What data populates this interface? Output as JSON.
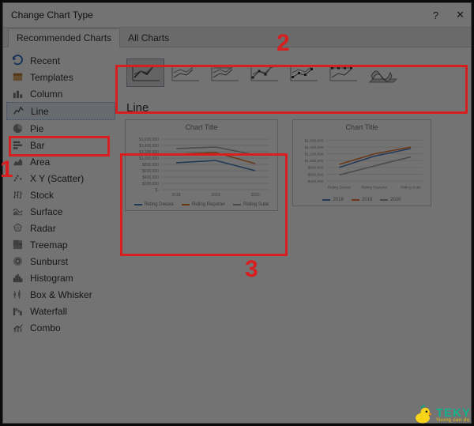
{
  "dialog": {
    "title": "Change Chart Type",
    "help": "?",
    "close": "✕"
  },
  "tabs": {
    "rec": "Recommended Charts",
    "all": "All Charts"
  },
  "sidebar": {
    "recent": "Recent",
    "templates": "Templates",
    "column": "Column",
    "line": "Line",
    "pie": "Pie",
    "bar": "Bar",
    "area": "Area",
    "xy": "X Y (Scatter)",
    "stock": "Stock",
    "surface": "Surface",
    "radar": "Radar",
    "treemap": "Treemap",
    "sunburst": "Sunburst",
    "histogram": "Histogram",
    "box": "Box & Whisker",
    "waterfall": "Waterfall",
    "combo": "Combo"
  },
  "subtype_label": "Line",
  "preview1": {
    "title": "Chart Title",
    "ylabels": [
      "$1,600,000",
      "$1,400,000",
      "$1,200,000",
      "$1,000,000",
      "$800,000",
      "$600,000",
      "$400,000",
      "$200,000",
      "$-"
    ],
    "xlabels": [
      "2018",
      "2019",
      "2020"
    ],
    "legend": [
      "Riding Deluxe",
      "Riding Reporter",
      "Riding Suite"
    ]
  },
  "preview2": {
    "title": "Chart Title",
    "ylabels": [
      "$1,600,000",
      "$1,400,000",
      "$1,200,000",
      "$1,000,000",
      "$800,000",
      "$600,000",
      "$400,000"
    ],
    "xlabels": [
      "Riding Deluxe",
      "Riding Reporter",
      "Riding Suite"
    ],
    "legend": [
      "2018",
      "2019",
      "2020"
    ]
  },
  "colors": {
    "s1": "#4a7cbf",
    "s2": "#ec7d31",
    "s3": "#a5a5a5"
  },
  "annotations": {
    "n1": "1",
    "n2": "2",
    "n3": "3"
  },
  "logo": {
    "brand": "TEKY",
    "tagline": "Young can do"
  },
  "chart_data": [
    {
      "type": "line",
      "title": "Chart Title",
      "x": [
        "2018",
        "2019",
        "2020"
      ],
      "ylim": [
        0,
        1600000
      ],
      "yformat": "$#,##0",
      "series": [
        {
          "name": "Riding Deluxe",
          "color": "#4a7cbf",
          "values": [
            850000,
            920000,
            600000
          ]
        },
        {
          "name": "Riding Reporter",
          "color": "#ec7d31",
          "values": [
            1120000,
            1160000,
            820000
          ]
        },
        {
          "name": "Riding Suite",
          "color": "#a5a5a5",
          "values": [
            1300000,
            1340000,
            1100000
          ]
        }
      ],
      "ylabel": "",
      "xlabel": ""
    },
    {
      "type": "line",
      "title": "Chart Title",
      "x": [
        "Riding Deluxe",
        "Riding Reporter",
        "Riding Suite"
      ],
      "ylim": [
        400000,
        1600000
      ],
      "yformat": "$#,##0",
      "series": [
        {
          "name": "2018",
          "color": "#4a7cbf",
          "values": [
            850000,
            1120000,
            1300000
          ]
        },
        {
          "name": "2019",
          "color": "#ec7d31",
          "values": [
            920000,
            1160000,
            1340000
          ]
        },
        {
          "name": "2020",
          "color": "#a5a5a5",
          "values": [
            600000,
            820000,
            1100000
          ]
        }
      ],
      "ylabel": "",
      "xlabel": ""
    }
  ]
}
